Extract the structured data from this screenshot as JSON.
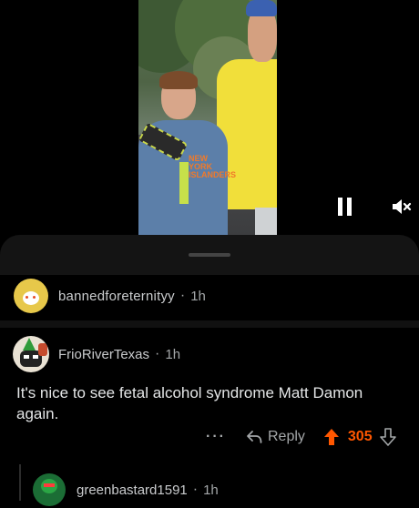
{
  "video": {
    "pause_icon": "pause-icon",
    "mute_icon": "volume-muted-icon",
    "shirt_text": "NEW YORK ISLANDERS"
  },
  "post": {
    "author": "bannedforeternityy",
    "separator": "·",
    "age": "1h"
  },
  "comment": {
    "author": "FrioRiverTexas",
    "separator": "·",
    "age": "1h",
    "body": "It's nice to see fetal alcohol syndrome Matt Damon again.",
    "more_label": "···",
    "reply_label": "Reply",
    "score": "305",
    "accent_color": "#ff5700"
  },
  "child_comment": {
    "author": "greenbastard1591",
    "separator": "·",
    "age": "1h"
  }
}
